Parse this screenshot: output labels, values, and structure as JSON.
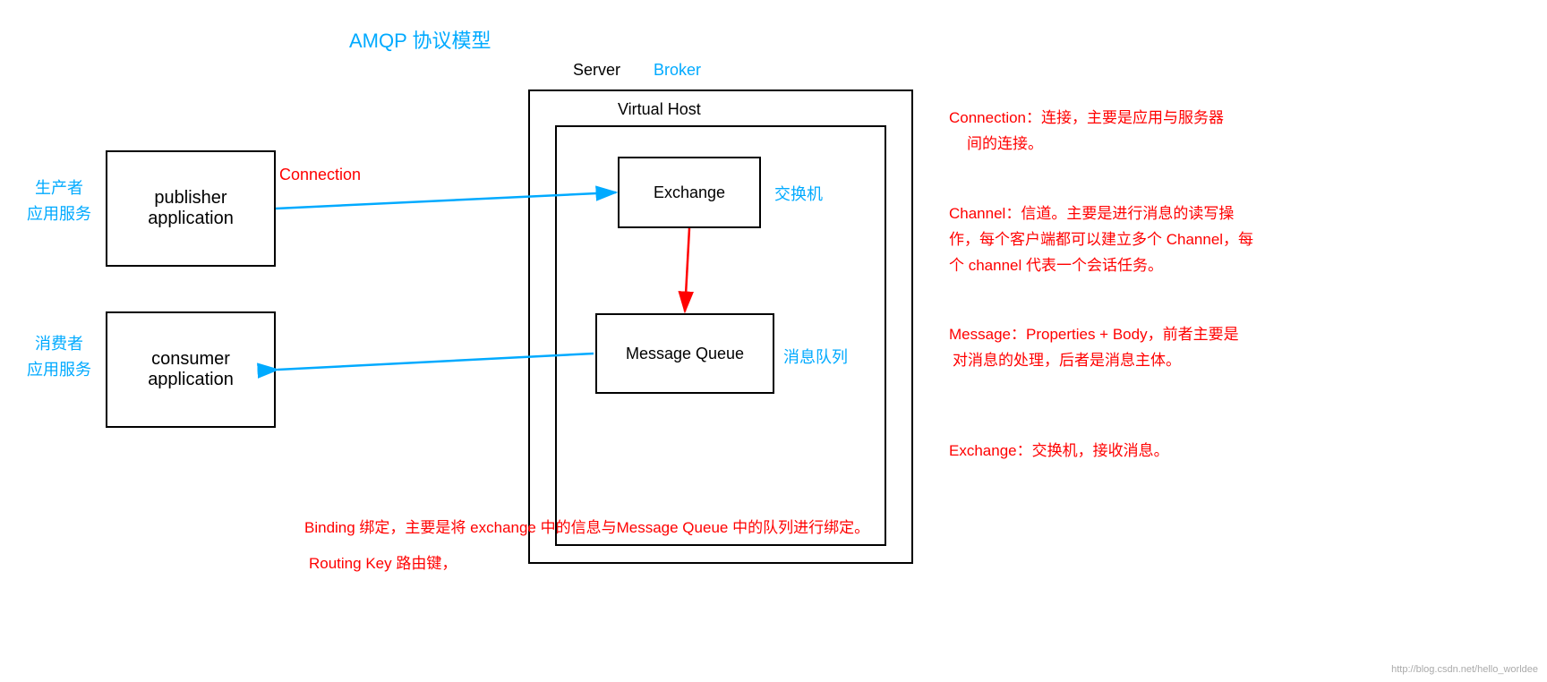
{
  "title": "AMQP 协议模型",
  "server_label": "Server",
  "broker_label": "Broker",
  "virtual_host_label": "Virtual Host",
  "publisher_box": "publisher\napplication",
  "consumer_box": "consumer\napplication",
  "exchange_box": "Exchange",
  "mq_box": "Message\nQueue",
  "producer_label_line1": "生产者",
  "producer_label_line2": "应用服务",
  "consumer_label_line1": "消费者",
  "consumer_label_line2": "应用服务",
  "connection_label": "Connection",
  "exchange_cn": "交换机",
  "mq_cn": "消息队列",
  "annotation1_prefix": "Connection：",
  "annotation1_text": "连接，主要是应用与服务器",
  "annotation1_line2": "间的连接。",
  "annotation2_prefix": "Channel：",
  "annotation2_text": "信道。主要是进行消息的读写操",
  "annotation2_line2": "作，每个客户端都可以建立多个 Channel，每",
  "annotation2_line3": "个 channel 代表一个会话任务。",
  "annotation3_prefix": "Message：",
  "annotation3_text": "Properties + Body，前者主要是",
  "annotation3_line2": "对消息的处理，后者是消息主体。",
  "annotation4_prefix": "Exchange：",
  "annotation4_text": "交换机，接收消息。",
  "bottom1": "Binding 绑定，主要是将 exchange 中的信息与Message Queue 中的队列进行绑定。",
  "bottom2": "Routing Key 路由键，",
  "watermark": "http://blog.csdn.net/hello_worldee"
}
